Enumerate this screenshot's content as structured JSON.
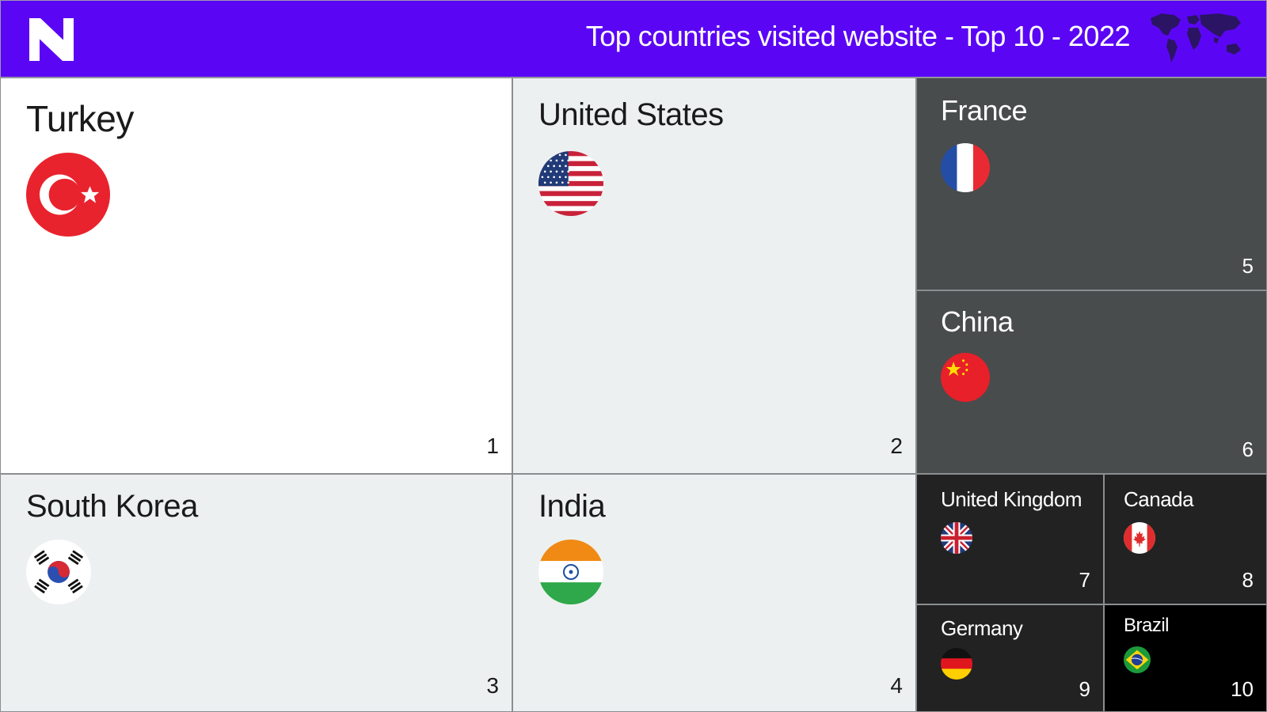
{
  "header": {
    "title": "Top countries visited website - Top 10 - 2022",
    "background": "#5a06f5",
    "logo_icon": "brand-logo-icon",
    "map_icon": "world-map-icon"
  },
  "chart_data": {
    "type": "table",
    "title": "Top countries visited website - Top 10 - 2022",
    "ranks": [
      {
        "country": "Turkey",
        "rank": "1",
        "flag": "turkey-flag-icon",
        "background": "#ffffff"
      },
      {
        "country": "United States",
        "rank": "2",
        "flag": "united-states-flag-icon",
        "background": "#ecf0f0"
      },
      {
        "country": "South Korea",
        "rank": "3",
        "flag": "south-korea-flag-icon",
        "background": "#ecf0f0"
      },
      {
        "country": "India",
        "rank": "4",
        "flag": "india-flag-icon",
        "background": "#ecf0f0"
      },
      {
        "country": "France",
        "rank": "5",
        "flag": "france-flag-icon",
        "background": "#484c4c"
      },
      {
        "country": "China",
        "rank": "6",
        "flag": "china-flag-icon",
        "background": "#484c4c"
      },
      {
        "country": "United Kingdom",
        "rank": "7",
        "flag": "united-kingdom-flag-icon",
        "background": "#222222"
      },
      {
        "country": "Canada",
        "rank": "8",
        "flag": "canada-flag-icon",
        "background": "#222222"
      },
      {
        "country": "Germany",
        "rank": "9",
        "flag": "germany-flag-icon",
        "background": "#222222"
      },
      {
        "country": "Brazil",
        "rank": "10",
        "flag": "brazil-flag-icon",
        "background": "#000000"
      }
    ]
  }
}
